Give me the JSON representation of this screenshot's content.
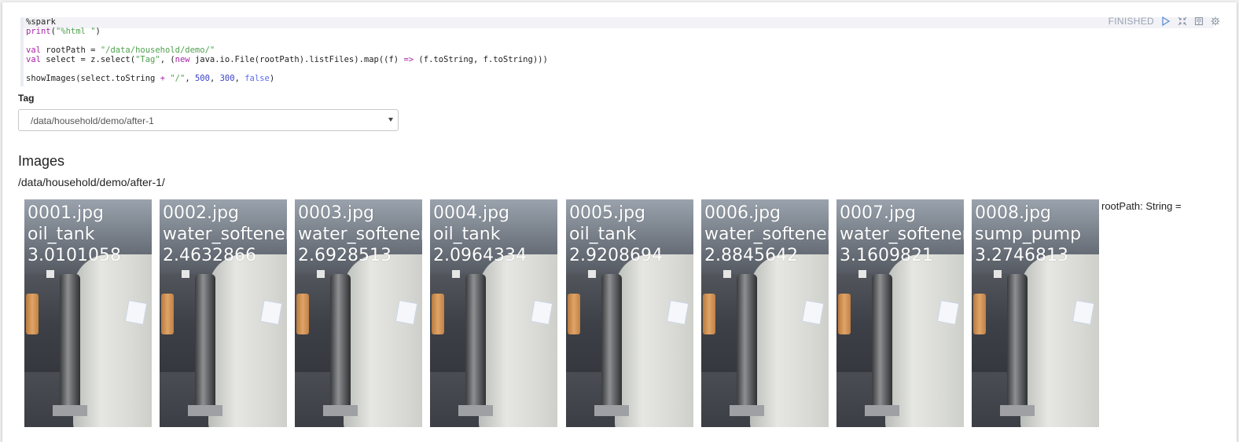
{
  "editor": {
    "lines": [
      [
        {
          "t": "%spark",
          "c": "plain"
        }
      ],
      [
        {
          "t": "print",
          "c": "kw"
        },
        {
          "t": "(",
          "c": "plain"
        },
        {
          "t": "\"%html \"",
          "c": "str"
        },
        {
          "t": ")",
          "c": "plain"
        }
      ],
      [
        {
          "t": "",
          "c": "plain"
        }
      ],
      [
        {
          "t": "val",
          "c": "kw"
        },
        {
          "t": " rootPath = ",
          "c": "plain"
        },
        {
          "t": "\"/data/household/demo/\"",
          "c": "str"
        }
      ],
      [
        {
          "t": "val",
          "c": "kw"
        },
        {
          "t": " select = z.select(",
          "c": "plain"
        },
        {
          "t": "\"Tag\"",
          "c": "str"
        },
        {
          "t": ", (",
          "c": "plain"
        },
        {
          "t": "new",
          "c": "kw"
        },
        {
          "t": " java.io.File(rootPath).listFiles).map((f) ",
          "c": "plain"
        },
        {
          "t": "=>",
          "c": "kw"
        },
        {
          "t": " (f.toString, f.toString)))",
          "c": "plain"
        }
      ],
      [
        {
          "t": "",
          "c": "plain"
        }
      ],
      [
        {
          "t": "showImages(select.toString ",
          "c": "plain"
        },
        {
          "t": "+",
          "c": "kw"
        },
        {
          "t": " ",
          "c": "plain"
        },
        {
          "t": "\"/\"",
          "c": "str"
        },
        {
          "t": ", ",
          "c": "plain"
        },
        {
          "t": "500",
          "c": "num"
        },
        {
          "t": ", ",
          "c": "plain"
        },
        {
          "t": "300",
          "c": "num"
        },
        {
          "t": ", ",
          "c": "plain"
        },
        {
          "t": "false",
          "c": "bool"
        },
        {
          "t": ")",
          "c": "plain"
        }
      ]
    ]
  },
  "status": {
    "label": "FINISHED",
    "icons": [
      "play-icon",
      "collapse-icon",
      "book-icon",
      "gear-icon"
    ]
  },
  "form": {
    "label": "Tag",
    "selected": "/data/household/demo/after-1"
  },
  "output": {
    "title": "Images",
    "path": "/data/household/demo/after-1/",
    "trailing_text": "rootPath: String ="
  },
  "images": [
    {
      "file": "0001.jpg",
      "tag": "oil_tank",
      "score": "3.0101058"
    },
    {
      "file": "0002.jpg",
      "tag": "water_softener",
      "score": "2.4632866"
    },
    {
      "file": "0003.jpg",
      "tag": "water_softener",
      "score": "2.6928513"
    },
    {
      "file": "0004.jpg",
      "tag": "oil_tank",
      "score": "2.0964334"
    },
    {
      "file": "0005.jpg",
      "tag": "oil_tank",
      "score": "2.9208694"
    },
    {
      "file": "0006.jpg",
      "tag": "water_softener",
      "score": "2.8845642"
    },
    {
      "file": "0007.jpg",
      "tag": "water_softener",
      "score": "3.1609821"
    },
    {
      "file": "0008.jpg",
      "tag": "sump_pump",
      "score": "3.2746813"
    }
  ]
}
